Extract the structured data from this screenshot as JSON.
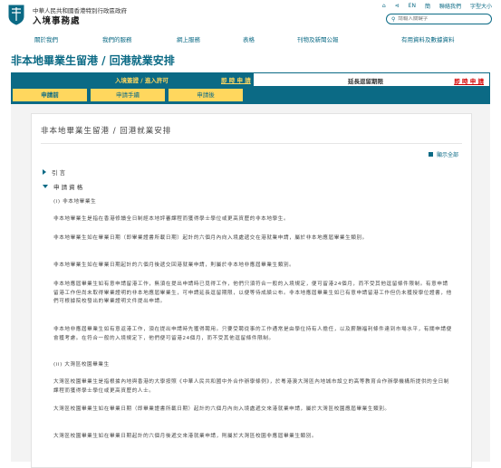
{
  "header": {
    "dept_line1": "中華人民共和國香港特別行政區政府",
    "dept_line2": "入境事務處",
    "top_links": [
      "EN",
      "簡",
      "聯絡我們",
      "字型大小"
    ],
    "search_placeholder": "請輸入關鍵字"
  },
  "nav": [
    "關於我們",
    "我們的服務",
    "網上服務",
    "表格",
    "刊物及新聞公報",
    "有用資料及數據資料"
  ],
  "page_title": "非本地畢業生留港 / 回港就業安排",
  "tabs": {
    "entry": {
      "label": "入境簽證 / 進入許可",
      "action": "即 時 申 請"
    },
    "extension": {
      "label": "延長逗留期限",
      "action": "即 時 申 請"
    },
    "subtabs": [
      "申請前",
      "申請手續",
      "申請後"
    ]
  },
  "card": {
    "title": "非本地畢業生留港 / 回港就業安排",
    "expand_all": "顯示全部",
    "section1": "引 言",
    "section2": "申 請 資 格",
    "p1": "(i) 非本地畢業生",
    "p2": "非本地畢業生是指在香港修讀全日制經本地評審課程而獲得學士學位或更高資歷的非本地學生。",
    "p3": "非本地畢業生如在畢業日期（即畢業證書所載日期）起計的六個月內向入境處遞交在港就業申請，屬於非本地應屆畢業生類別。",
    "p4": "非本地畢業生如在畢業日期起計的六個月後遞交回港就業申請，則屬於非本地非應屆畢業生類別。",
    "p5": "非本地應屆畢業生如有意申請留港工作，無須在提出申請時已覓得工作，他們只須符合一般的入境規定，便可留港24個月，而不受其他逗留條件限制。有意申請留港工作但尚未取得畢業證明的非本地應屆畢業生，可申請延長逗留期限，以便等待成績公布。非本地應屆畢業生如已有意申請留港工作但仍未獲授學位證書，他們可根據院校發出的畢業證明文件提出申請。",
    "p6": "非本地非應屆畢業生如有意返港工作，須在提出申請時先獲得聘用。只要受聘從事的工作通常是由學位持有人擔任，以及薪酬福利條件達到市場水平，有關申請便會獲考慮。在符合一般的入境規定下，他們便可留港24個月，而不受其他逗留條件限制。",
    "p7": "(ii) 大灣區校園畢業生",
    "p8": "大灣區校園畢業生是指根據內地與香港的大學按照《中華人民共和國中外合作辦學條例》，於粵港澳大灣區內地城市設立的高等教育合作辦學機構所提供的全日制課程而獲得學士學位或更高資歷的人士。",
    "p9": "大灣區校園畢業生如在畢業日期（即畢業證書所載日期）起計的六個月內向入境處遞交來港就業申請，屬於大灣區校園應屆畢業生類別。",
    "p10": "大灣區校園畢業生如在畢業日期起計的六個月後遞交來港就業申請，則屬於大灣區校園非應屆畢業生類別。"
  }
}
